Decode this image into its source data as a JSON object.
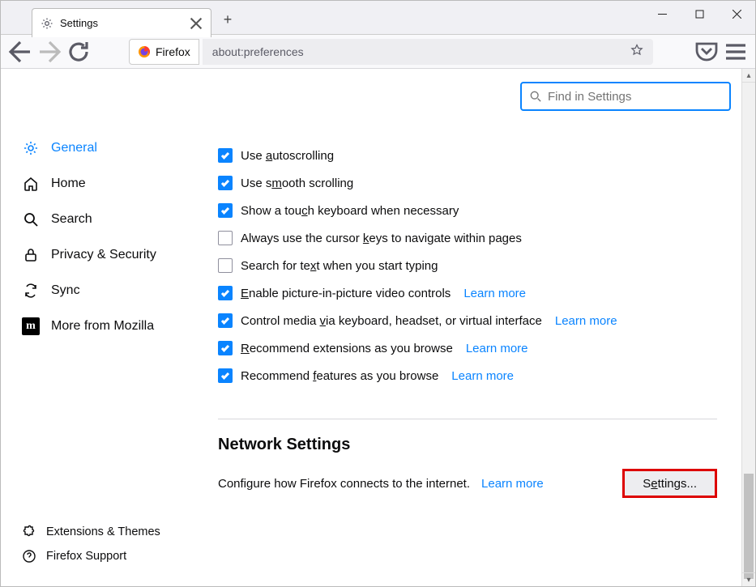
{
  "tab": {
    "title": "Settings"
  },
  "urlbar": {
    "identity_label": "Firefox",
    "url": "about:preferences"
  },
  "search": {
    "placeholder": "Find in Settings"
  },
  "sidebar": {
    "items": [
      {
        "label": "General"
      },
      {
        "label": "Home"
      },
      {
        "label": "Search"
      },
      {
        "label": "Privacy & Security"
      },
      {
        "label": "Sync"
      },
      {
        "label": "More from Mozilla"
      }
    ],
    "bottom": [
      {
        "label": "Extensions & Themes"
      },
      {
        "label": "Firefox Support"
      }
    ]
  },
  "options": [
    {
      "checked": true,
      "label_pre": "Use ",
      "ul": "a",
      "label_post": "utoscrolling",
      "learn": false
    },
    {
      "checked": true,
      "label_pre": "Use s",
      "ul": "m",
      "label_post": "ooth scrolling",
      "learn": false
    },
    {
      "checked": true,
      "label_pre": "Show a tou",
      "ul": "c",
      "label_post": "h keyboard when necessary",
      "learn": false
    },
    {
      "checked": false,
      "label_pre": "Always use the cursor ",
      "ul": "k",
      "label_post": "eys to navigate within pages",
      "learn": false
    },
    {
      "checked": false,
      "label_pre": "Search for te",
      "ul": "x",
      "label_post": "t when you start typing",
      "learn": false
    },
    {
      "checked": true,
      "label_pre": "",
      "ul": "E",
      "label_post": "nable picture-in-picture video controls",
      "learn": true
    },
    {
      "checked": true,
      "label_pre": "Control media ",
      "ul": "v",
      "label_post": "ia keyboard, headset, or virtual interface",
      "learn": true
    },
    {
      "checked": true,
      "label_pre": "",
      "ul": "R",
      "label_post": "ecommend extensions as you browse",
      "learn": true
    },
    {
      "checked": true,
      "label_pre": "Recommend ",
      "ul": "f",
      "label_post": "eatures as you browse",
      "learn": true
    }
  ],
  "learn_more": "Learn more",
  "network": {
    "title": "Network Settings",
    "desc": "Configure how Firefox connects to the internet.",
    "button_pre": "S",
    "button_ul": "e",
    "button_post": "ttings..."
  }
}
